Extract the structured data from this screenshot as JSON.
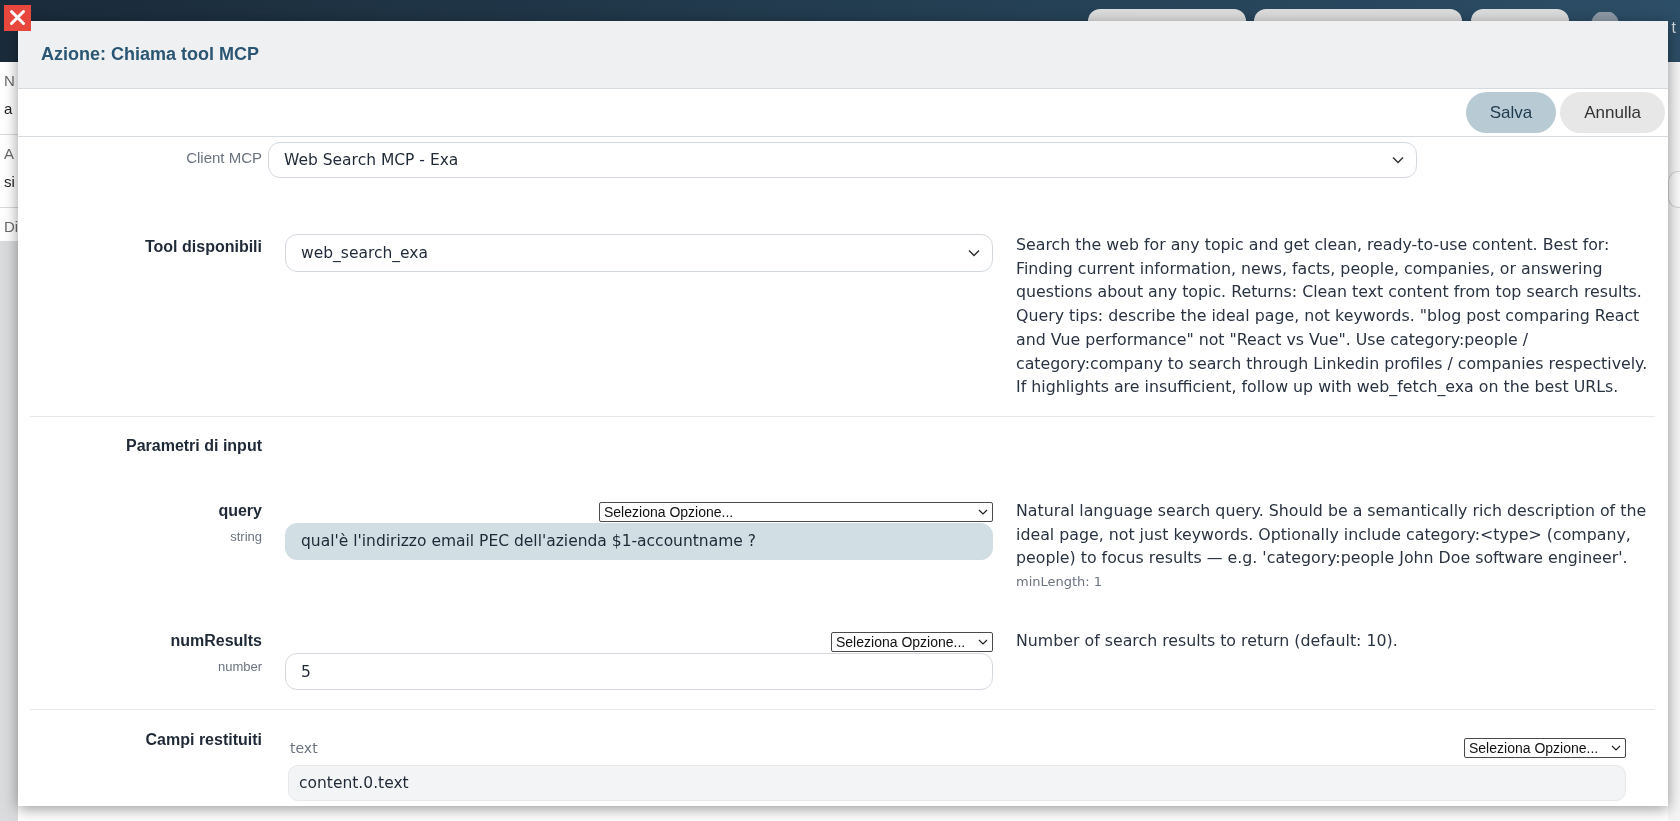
{
  "top_bar": {
    "text": "t"
  },
  "background_page": {
    "fields": [
      {
        "label": "N",
        "value": "a"
      },
      {
        "label": "A",
        "value": "si"
      },
      {
        "label": "Di"
      }
    ]
  },
  "dialog": {
    "title": "Azione: Chiama tool MCP",
    "buttons": [
      {
        "label": "Salva",
        "kind": "primary"
      },
      {
        "label": "Annulla",
        "kind": "secondary"
      }
    ]
  },
  "client": {
    "label": "Client MCP",
    "value": "Web Search MCP - Exa"
  },
  "tool": {
    "label": "Tool disponibili",
    "value": "web_search_exa",
    "description": "Search the web for any topic and get clean, ready-to-use content. Best for: Finding current information, news, facts, people, companies, or answering questions about any topic. Returns: Clean text content from top search results. Query tips: describe the ideal page, not keywords. \"blog post comparing React and Vue performance\" not \"React vs Vue\". Use category:people / category:company to search through Linkedin profiles / companies respectively. If highlights are insufficient, follow up with web_fetch_exa on the best URLs."
  },
  "input_parameters": {
    "label": "Parametri di input",
    "params": [
      {
        "name": "query",
        "type": "string",
        "option_select": "Seleziona Opzione...",
        "value": "qual'è l'indirizzo email PEC dell'azienda $1-accountname ?",
        "highlighted": true,
        "description": "Natural language search query. Should be a semantically rich description of the ideal page, not just keywords. Optionally include category:<type> (company, people) to focus results — e.g. 'category:people John Doe software engineer'.",
        "constraint": "minLength: 1"
      },
      {
        "name": "numResults",
        "type": "number",
        "option_select": "Seleziona Opzione...",
        "value": "5",
        "highlighted": false,
        "description": "Number of search results to return (default: 10)."
      }
    ]
  },
  "returned_fields": {
    "label": "Campi restituiti",
    "fields": [
      {
        "name": "text",
        "option_select": "Seleziona Opzione...",
        "value": "content.0.text"
      }
    ]
  }
}
